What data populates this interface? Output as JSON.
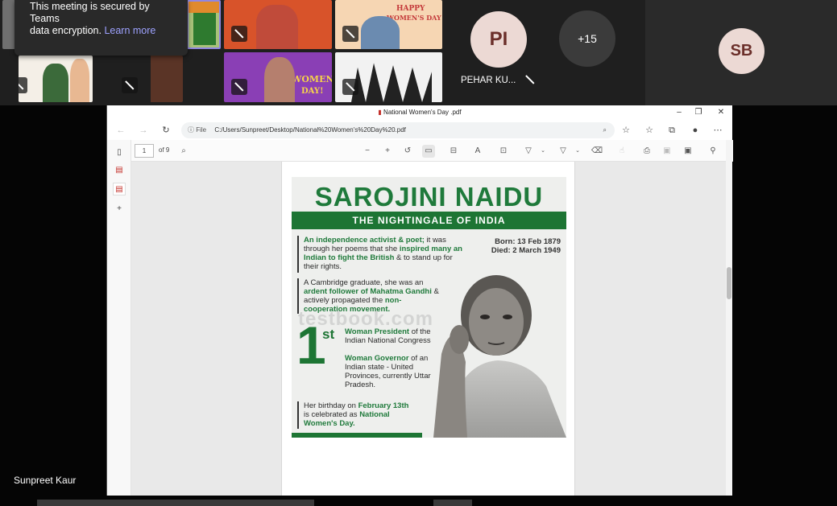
{
  "meeting": {
    "toast_line1": "This meeting is secured by Teams",
    "toast_line2": "data encryption.",
    "toast_link": "Learn more",
    "participants": [
      {
        "initials": "PI",
        "name": "PEHAR KU..."
      },
      {
        "overflow": "+15"
      },
      {
        "initials": "SB"
      }
    ],
    "tile_texts": {
      "happy": "HAPPY",
      "womens_day": "WOMEN'S DAY",
      "y": "Y",
      "womens": "WOMEN'S",
      "day_excl": "DAY!"
    },
    "presenter_name": "Sunpreet Kaur"
  },
  "browser": {
    "tab_title": "National Women's Day .pdf",
    "url_prefix": "File",
    "url": "C:/Users/Sunpreet/Desktop/National%20Women's%20Day%20.pdf"
  },
  "pdf": {
    "page_current": "1",
    "page_total": "of 9"
  },
  "poster": {
    "title": "SAROJINI NAIDU",
    "subtitle": "THE NIGHTINGALE OF INDIA",
    "born": "Born: 13 Feb 1879",
    "died": "Died: 2 March 1949",
    "p1_a": "An independence activist & poet;",
    "p1_b": " it was through her poems that she ",
    "p1_c": "inspired many an Indian to fight the British",
    "p1_d": " & to stand up for their rights.",
    "p2_a": "A Cambridge graduate, she was an ",
    "p2_b": "ardent follower of Mahatma Gandhi",
    "p2_c": " & actively propagated the ",
    "p2_d": "non-cooperation movement.",
    "first_num": "1",
    "first_sup": "st",
    "f1_a": "Woman President",
    "f1_b": " of the Indian National Congress",
    "f2_a": "Woman Governor",
    "f2_b": " of an Indian state - United Provinces, currently Uttar Pradesh.",
    "b_a": "Her birthday on ",
    "b_b": "February 13th",
    "b_c": " is celebrated as ",
    "b_d": "National Women's Day.",
    "watermark": "testbook.com"
  },
  "colors": {
    "poster_green": "#1d7534",
    "teams_bg": "#1f1f1f",
    "link": "#9ea2ff"
  }
}
